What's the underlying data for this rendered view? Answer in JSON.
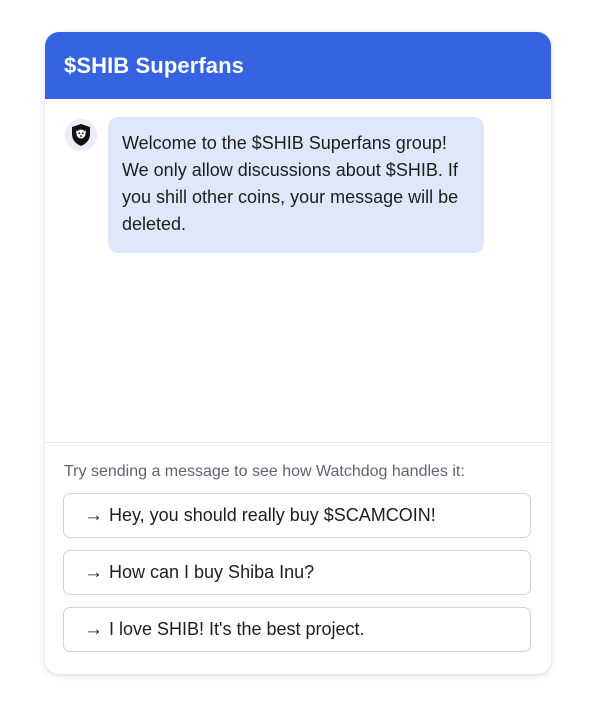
{
  "header": {
    "title": "$SHIB Superfans"
  },
  "chat": {
    "avatar_icon": "shield-dog-icon",
    "message": "Welcome to the $SHIB Superfans group! We only allow discussions about $SHIB. If you shill other coins, your message will be deleted."
  },
  "suggestions": {
    "hint": "Try sending a message to see how Watchdog handles it:",
    "arrow": "→",
    "items": [
      {
        "label": "Hey, you should really buy $SCAMCOIN!"
      },
      {
        "label": "How can I buy Shiba Inu?"
      },
      {
        "label": "I love SHIB! It's the best project."
      }
    ]
  },
  "colors": {
    "header_bg": "#3563e2",
    "bubble_bg": "#dfe8f9"
  }
}
